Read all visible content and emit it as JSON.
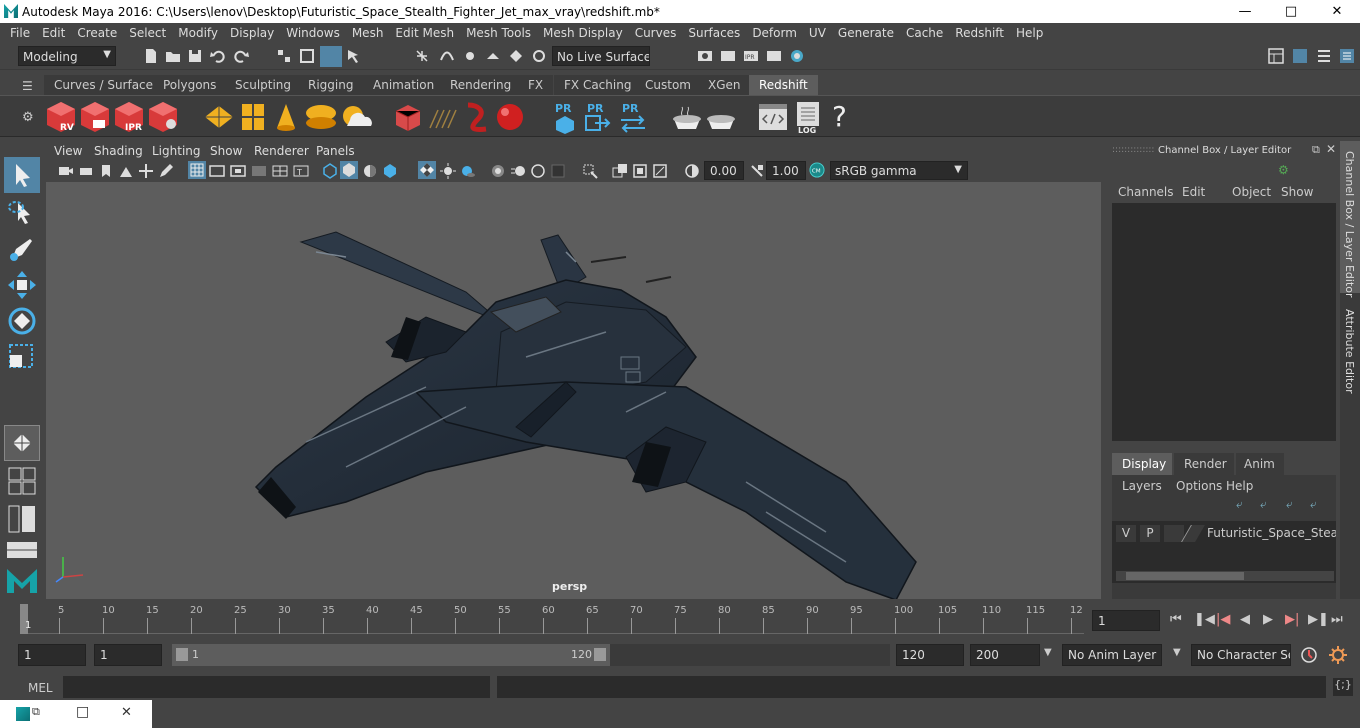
{
  "window": {
    "title": "Autodesk Maya 2016: C:\\Users\\lenov\\Desktop\\Futuristic_Space_Stealth_Fighter_Jet_max_vray\\redshift.mb*"
  },
  "menu": [
    "File",
    "Edit",
    "Create",
    "Select",
    "Modify",
    "Display",
    "Windows",
    "Mesh",
    "Edit Mesh",
    "Mesh Tools",
    "Mesh Display",
    "Curves",
    "Surfaces",
    "Deform",
    "UV",
    "Generate",
    "Cache",
    "Redshift",
    "Help"
  ],
  "toolbar": {
    "mode": "Modeling",
    "live_surface": "No Live Surface"
  },
  "shelf_tabs": [
    "Curves / Surfaces",
    "Polygons",
    "Sculpting",
    "Rigging",
    "Animation",
    "Rendering",
    "FX",
    "FX Caching",
    "Custom",
    "XGen",
    "Redshift"
  ],
  "shelf_icon_labels": {
    "rv": "RV",
    "ipr": "IPR",
    "pr1": "PR",
    "pr2": "PR",
    "pr3": "PR",
    "log": "LOG",
    "help": "?"
  },
  "panel_menu": [
    "View",
    "Shading",
    "Lighting",
    "Show",
    "Renderer",
    "Panels"
  ],
  "view_tools": {
    "exposure": "0.00",
    "gamma": "1.00",
    "colorspace": "sRGB gamma"
  },
  "viewport": {
    "camera_label": "persp"
  },
  "channel_box": {
    "title": "Channel Box / Layer Editor",
    "menu": [
      "Channels",
      "Edit",
      "Object",
      "Show"
    ],
    "tabs": [
      "Display",
      "Render",
      "Anim"
    ],
    "layer_menu": [
      "Layers",
      "Options",
      "Help"
    ],
    "layer": {
      "v": "V",
      "p": "P",
      "name": "Futuristic_Space_Stealth_"
    }
  },
  "side_tabs": [
    "Channel Box / Layer Editor",
    "Attribute Editor"
  ],
  "timeline": {
    "ticks": [
      "5",
      "10",
      "15",
      "20",
      "25",
      "30",
      "35",
      "40",
      "45",
      "50",
      "55",
      "60",
      "65",
      "70",
      "75",
      "80",
      "85",
      "90",
      "95",
      "100",
      "105",
      "110",
      "115",
      "12"
    ],
    "start_mark": "1",
    "current_frame": "1"
  },
  "range": {
    "start": "1",
    "playback_start": "1",
    "slider_start": "1",
    "slider_end": "120",
    "end": "120",
    "anim_end": "200",
    "anim_layer": "No Anim Layer",
    "char_set": "No Character Set"
  },
  "command": {
    "lang": "MEL"
  }
}
